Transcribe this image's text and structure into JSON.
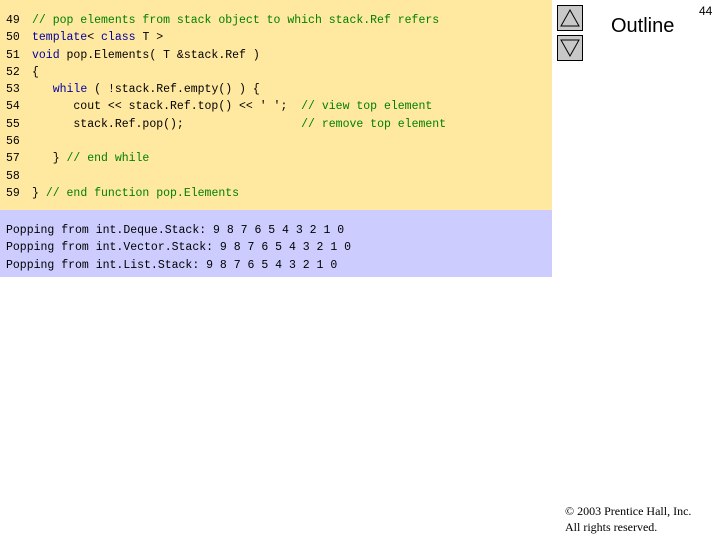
{
  "code_lines": [
    {
      "num": "49",
      "parts": [
        {
          "t": "// pop elements from stack object to which stack.Ref refers",
          "c": "cm"
        }
      ]
    },
    {
      "num": "50",
      "parts": [
        {
          "t": "template",
          "c": "kw"
        },
        {
          "t": "< ",
          "c": ""
        },
        {
          "t": "class",
          "c": "kw"
        },
        {
          "t": " T >",
          "c": ""
        }
      ]
    },
    {
      "num": "51",
      "parts": [
        {
          "t": "void",
          "c": "kw"
        },
        {
          "t": " pop.Elements( T &stack.Ref )",
          "c": ""
        }
      ]
    },
    {
      "num": "52",
      "parts": [
        {
          "t": "{",
          "c": ""
        }
      ]
    },
    {
      "num": "53",
      "parts": [
        {
          "t": "   ",
          "c": ""
        },
        {
          "t": "while",
          "c": "kw"
        },
        {
          "t": " ( !stack.Ref.empty() ) {",
          "c": ""
        }
      ]
    },
    {
      "num": "54",
      "parts": [
        {
          "t": "      cout << stack.Ref.top() << ' ';  ",
          "c": ""
        },
        {
          "t": "// view top element",
          "c": "cm"
        }
      ]
    },
    {
      "num": "55",
      "parts": [
        {
          "t": "      stack.Ref.pop();                 ",
          "c": ""
        },
        {
          "t": "// remove top element",
          "c": "cm"
        }
      ]
    },
    {
      "num": "56",
      "parts": []
    },
    {
      "num": "57",
      "parts": [
        {
          "t": "   } ",
          "c": ""
        },
        {
          "t": "// end while",
          "c": "cm"
        }
      ]
    },
    {
      "num": "58",
      "parts": []
    },
    {
      "num": "59",
      "parts": [
        {
          "t": "} ",
          "c": ""
        },
        {
          "t": "// end function pop.Elements",
          "c": "cm"
        }
      ]
    }
  ],
  "output_lines": [
    "Popping from int.Deque.Stack: 9 8 7 6 5 4 3 2 1 0",
    "Popping from int.Vector.Stack: 9 8 7 6 5 4 3 2 1 0",
    "Popping from int.List.Stack: 9 8 7 6 5 4 3 2 1 0"
  ],
  "sidebar": {
    "outline_label": "Outline",
    "page_number": "44",
    "copyright_line1": "© 2003 Prentice Hall, Inc.",
    "copyright_line2": "All rights reserved."
  },
  "colors": {
    "code_background": "#ffe8a0",
    "output_background": "#ccccff",
    "keyword": "#0000a0",
    "comment": "#008000"
  },
  "icons": {
    "prev": "up-triangle-icon",
    "next": "down-triangle-icon"
  }
}
